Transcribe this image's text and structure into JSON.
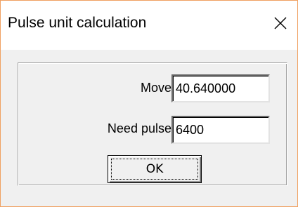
{
  "window": {
    "title": "Pulse unit calculation",
    "close_icon": "close-icon",
    "border_color": "#f0a060"
  },
  "form": {
    "move_label": "Move:",
    "move_value": "40.640000",
    "need_pulse_label": "Need pulse:",
    "need_pulse_value": "6400",
    "ok_label": "OK"
  }
}
